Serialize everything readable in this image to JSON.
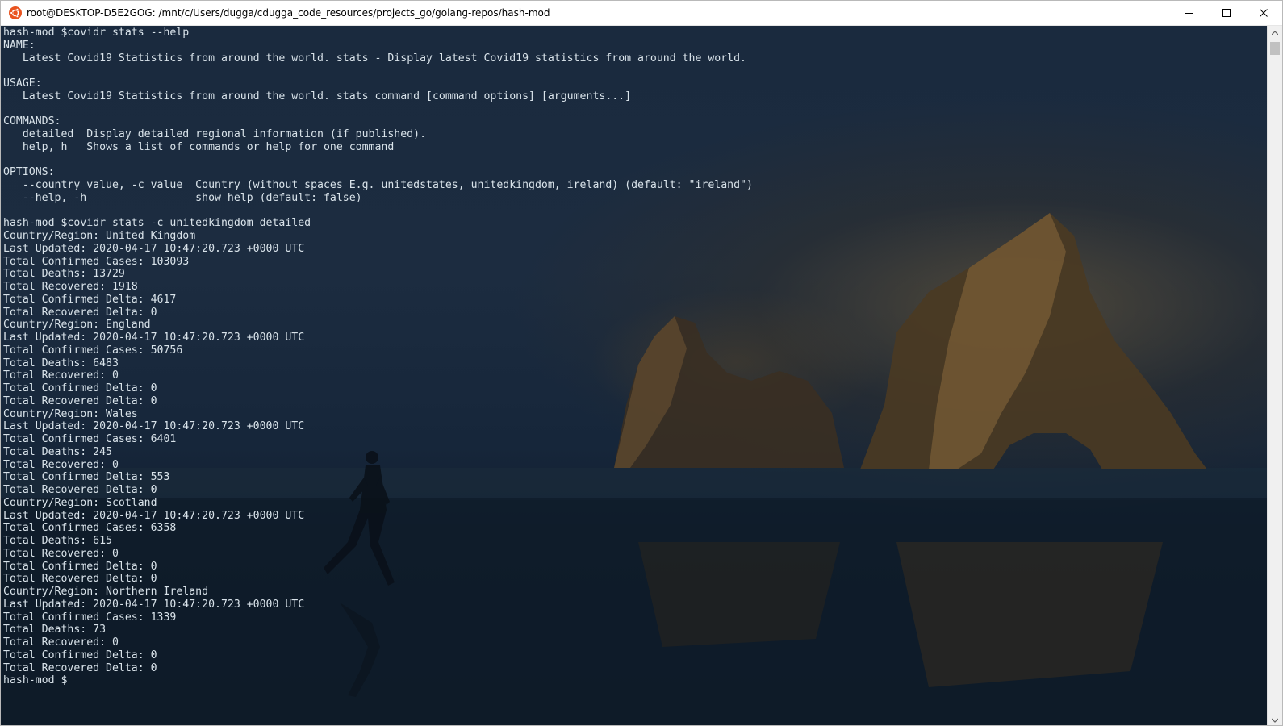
{
  "window": {
    "title": "root@DESKTOP-D5E2GOG: /mnt/c/Users/dugga/cdugga_code_resources/projects_go/golang-repos/hash-mod",
    "app_icon": "ubuntu-icon",
    "buttons": {
      "minimize": "minimize-icon",
      "maximize": "maximize-icon",
      "close": "close-icon"
    }
  },
  "colors": {
    "terminal_text": "#d9e3ea",
    "titlebar_bg": "#ffffff"
  },
  "terminal": {
    "lines": [
      "hash-mod $covidr stats --help",
      "NAME:",
      "   Latest Covid19 Statistics from around the world. stats - Display latest Covid19 statistics from around the world.",
      "",
      "USAGE:",
      "   Latest Covid19 Statistics from around the world. stats command [command options] [arguments...]",
      "",
      "COMMANDS:",
      "   detailed  Display detailed regional information (if published).",
      "   help, h   Shows a list of commands or help for one command",
      "",
      "OPTIONS:",
      "   --country value, -c value  Country (without spaces E.g. unitedstates, unitedkingdom, ireland) (default: \"ireland\")",
      "   --help, -h                 show help (default: false)",
      "",
      "hash-mod $covidr stats -c unitedkingdom detailed",
      "Country/Region: United Kingdom",
      "Last Updated: 2020-04-17 10:47:20.723 +0000 UTC",
      "Total Confirmed Cases: 103093",
      "Total Deaths: 13729",
      "Total Recovered: 1918",
      "Total Confirmed Delta: 4617",
      "Total Recovered Delta: 0",
      "Country/Region: England",
      "Last Updated: 2020-04-17 10:47:20.723 +0000 UTC",
      "Total Confirmed Cases: 50756",
      "Total Deaths: 6483",
      "Total Recovered: 0",
      "Total Confirmed Delta: 0",
      "Total Recovered Delta: 0",
      "Country/Region: Wales",
      "Last Updated: 2020-04-17 10:47:20.723 +0000 UTC",
      "Total Confirmed Cases: 6401",
      "Total Deaths: 245",
      "Total Recovered: 0",
      "Total Confirmed Delta: 553",
      "Total Recovered Delta: 0",
      "Country/Region: Scotland",
      "Last Updated: 2020-04-17 10:47:20.723 +0000 UTC",
      "Total Confirmed Cases: 6358",
      "Total Deaths: 615",
      "Total Recovered: 0",
      "Total Confirmed Delta: 0",
      "Total Recovered Delta: 0",
      "Country/Region: Northern Ireland",
      "Last Updated: 2020-04-17 10:47:20.723 +0000 UTC",
      "Total Confirmed Cases: 1339",
      "Total Deaths: 73",
      "Total Recovered: 0",
      "Total Confirmed Delta: 0",
      "Total Recovered Delta: 0",
      "hash-mod $"
    ]
  }
}
